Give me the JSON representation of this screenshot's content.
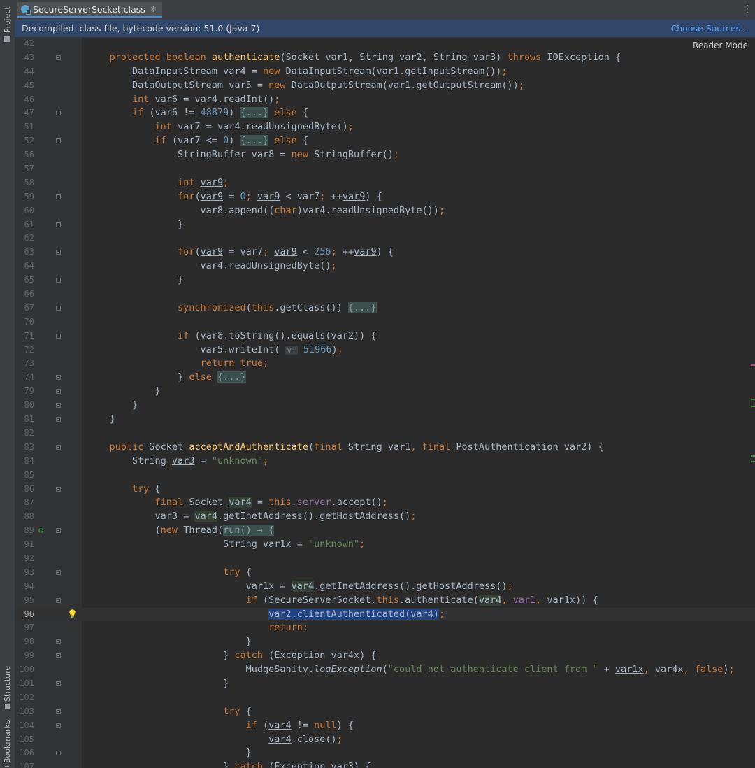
{
  "left_strip": {
    "tabs": [
      {
        "label": "Project"
      },
      {
        "label": "Structure"
      },
      {
        "label": "Bookmarks"
      }
    ]
  },
  "tab": {
    "title": "SecureServerSocket.class",
    "pin": "✻",
    "icon": "java-class-icon"
  },
  "banner": {
    "text": "Decompiled .class file, bytecode version: 51.0 (Java 7)",
    "link": "Choose Sources..."
  },
  "reader_mode": "Reader Mode",
  "editor": {
    "current_line": 96,
    "lines": [
      {
        "n": "42",
        "fold": "",
        "t": []
      },
      {
        "n": "43",
        "fold": "open",
        "t": [
          [
            "    "
          ],
          [
            "protected",
            "kw"
          ],
          [
            " "
          ],
          [
            "boolean",
            "kw"
          ],
          [
            " "
          ],
          [
            "authenticate",
            "fn"
          ],
          [
            "(Socket var1, String var2, String var3) "
          ],
          [
            "throws",
            "kw"
          ],
          [
            " IOException {"
          ]
        ]
      },
      {
        "n": "44",
        "fold": "",
        "t": [
          [
            "        DataInputStream var4 = "
          ],
          [
            "new",
            "kw"
          ],
          [
            " DataInputStream(var1.getInputStream())"
          ],
          [
            ";",
            "kw"
          ]
        ]
      },
      {
        "n": "45",
        "fold": "",
        "t": [
          [
            "        DataOutputStream var5 = "
          ],
          [
            "new",
            "kw"
          ],
          [
            " DataOutputStream(var1.getOutputStream())"
          ],
          [
            ";",
            "kw"
          ]
        ]
      },
      {
        "n": "46",
        "fold": "",
        "t": [
          [
            "        "
          ],
          [
            "int",
            "kw"
          ],
          [
            " var6 = var4.readInt()"
          ],
          [
            ";",
            "kw"
          ]
        ]
      },
      {
        "n": "47",
        "fold": "open",
        "t": [
          [
            "        "
          ],
          [
            "if",
            "kw"
          ],
          [
            " (var6 != "
          ],
          [
            "48879",
            "num"
          ],
          [
            ") "
          ],
          [
            "{...}",
            "fold"
          ],
          [
            " "
          ],
          [
            "else",
            "kw"
          ],
          [
            " {"
          ]
        ]
      },
      {
        "n": "51",
        "fold": "",
        "t": [
          [
            "            "
          ],
          [
            "int",
            "kw"
          ],
          [
            " var7 = var4.readUnsignedByte()"
          ],
          [
            ";",
            "kw"
          ]
        ]
      },
      {
        "n": "52",
        "fold": "open",
        "t": [
          [
            "            "
          ],
          [
            "if",
            "kw"
          ],
          [
            " (var7 <= "
          ],
          [
            "0",
            "num"
          ],
          [
            ") "
          ],
          [
            "{...}",
            "fold"
          ],
          [
            " "
          ],
          [
            "else",
            "kw"
          ],
          [
            " {"
          ]
        ]
      },
      {
        "n": "56",
        "fold": "",
        "t": [
          [
            "                StringBuffer var8 = "
          ],
          [
            "new",
            "kw"
          ],
          [
            " StringBuffer()"
          ],
          [
            ";",
            "kw"
          ]
        ]
      },
      {
        "n": "57",
        "fold": "",
        "t": []
      },
      {
        "n": "58",
        "fold": "",
        "t": [
          [
            "                "
          ],
          [
            "int",
            "kw"
          ],
          [
            " "
          ],
          [
            "var9",
            "ul"
          ],
          [
            ";",
            "kw"
          ]
        ]
      },
      {
        "n": "59",
        "fold": "open",
        "t": [
          [
            "                "
          ],
          [
            "for",
            "kw"
          ],
          [
            "("
          ],
          [
            "var9",
            "ul"
          ],
          [
            " = "
          ],
          [
            "0",
            "num"
          ],
          [
            "; ",
            "kw"
          ],
          [
            "var9",
            "ul"
          ],
          [
            " < var7"
          ],
          [
            "; ",
            "kw"
          ],
          [
            "++"
          ],
          [
            "var9",
            "ul"
          ],
          [
            ") {"
          ]
        ]
      },
      {
        "n": "60",
        "fold": "",
        "t": [
          [
            "                    var8.append(("
          ],
          [
            "char",
            "kw"
          ],
          [
            ")var4.readUnsignedByte())"
          ],
          [
            ";",
            "kw"
          ]
        ]
      },
      {
        "n": "61",
        "fold": "open",
        "t": [
          [
            "                }"
          ]
        ]
      },
      {
        "n": "62",
        "fold": "",
        "t": []
      },
      {
        "n": "63",
        "fold": "open",
        "t": [
          [
            "                "
          ],
          [
            "for",
            "kw"
          ],
          [
            "("
          ],
          [
            "var9",
            "ul"
          ],
          [
            " = var7"
          ],
          [
            "; ",
            "kw"
          ],
          [
            "var9",
            "ul"
          ],
          [
            " < "
          ],
          [
            "256",
            "num"
          ],
          [
            "; ",
            "kw"
          ],
          [
            "++"
          ],
          [
            "var9",
            "ul"
          ],
          [
            ") {"
          ]
        ]
      },
      {
        "n": "64",
        "fold": "",
        "t": [
          [
            "                    var4.readUnsignedByte()"
          ],
          [
            ";",
            "kw"
          ]
        ]
      },
      {
        "n": "65",
        "fold": "open",
        "t": [
          [
            "                }"
          ]
        ]
      },
      {
        "n": "66",
        "fold": "",
        "t": []
      },
      {
        "n": "67",
        "fold": "open",
        "t": [
          [
            "                "
          ],
          [
            "synchronized",
            "kw"
          ],
          [
            "("
          ],
          [
            "this",
            "kw"
          ],
          [
            ".getClass()) "
          ],
          [
            "{...}",
            "fold"
          ]
        ]
      },
      {
        "n": "70",
        "fold": "",
        "t": []
      },
      {
        "n": "71",
        "fold": "open",
        "t": [
          [
            "                "
          ],
          [
            "if",
            "kw"
          ],
          [
            " (var8.toString().equals(var2)) {"
          ]
        ]
      },
      {
        "n": "72",
        "fold": "",
        "t": [
          [
            "                    var5.writeInt( "
          ],
          [
            "v:",
            "hint"
          ],
          [
            " "
          ],
          [
            "51966",
            "num"
          ],
          [
            ")"
          ],
          [
            ";",
            "kw"
          ]
        ]
      },
      {
        "n": "73",
        "fold": "",
        "t": [
          [
            "                    "
          ],
          [
            "return true;",
            "kw"
          ]
        ]
      },
      {
        "n": "74",
        "fold": "open",
        "t": [
          [
            "                } "
          ],
          [
            "else",
            "kw"
          ],
          [
            " "
          ],
          [
            "{...}",
            "fold"
          ]
        ]
      },
      {
        "n": "79",
        "fold": "open",
        "t": [
          [
            "            }"
          ]
        ]
      },
      {
        "n": "80",
        "fold": "open",
        "t": [
          [
            "        }"
          ]
        ]
      },
      {
        "n": "81",
        "fold": "open",
        "t": [
          [
            "    }"
          ]
        ]
      },
      {
        "n": "82",
        "fold": "",
        "t": []
      },
      {
        "n": "83",
        "fold": "open",
        "t": [
          [
            "    "
          ],
          [
            "public",
            "kw"
          ],
          [
            " Socket "
          ],
          [
            "acceptAndAuthenticate",
            "fn"
          ],
          [
            "("
          ],
          [
            "final",
            "kw"
          ],
          [
            " String var1"
          ],
          [
            ", ",
            "kw"
          ],
          [
            "final",
            "kw"
          ],
          [
            " PostAuthentication var2) {"
          ]
        ]
      },
      {
        "n": "84",
        "fold": "",
        "t": [
          [
            "        String "
          ],
          [
            "var3",
            "ul"
          ],
          [
            " = "
          ],
          [
            "\"unknown\"",
            "str"
          ],
          [
            ";",
            "kw"
          ]
        ]
      },
      {
        "n": "85",
        "fold": "",
        "t": []
      },
      {
        "n": "86",
        "fold": "open",
        "t": [
          [
            "        "
          ],
          [
            "try",
            "kw"
          ],
          [
            " {"
          ]
        ]
      },
      {
        "n": "87",
        "fold": "",
        "t": [
          [
            "            "
          ],
          [
            "final",
            "kw"
          ],
          [
            " Socket "
          ],
          [
            "var4",
            "ulhl"
          ],
          [
            " = "
          ],
          [
            "this",
            "kw"
          ],
          [
            "."
          ],
          [
            "server",
            "fld"
          ],
          [
            ".accept()"
          ],
          [
            ";",
            "kw"
          ]
        ]
      },
      {
        "n": "88",
        "fold": "",
        "t": [
          [
            "            "
          ],
          [
            "var3",
            "ul"
          ],
          [
            " = "
          ],
          [
            "var4",
            "hl"
          ],
          [
            ".getInetAddress().getHostAddress()"
          ],
          [
            ";",
            "kw"
          ]
        ]
      },
      {
        "n": "89",
        "fold": "open",
        "run": true,
        "t": [
          [
            "            ("
          ],
          [
            "new",
            "kw"
          ],
          [
            " Thread("
          ],
          [
            "run() → {",
            "fold"
          ]
        ]
      },
      {
        "n": "91",
        "fold": "",
        "t": [
          [
            "                        String "
          ],
          [
            "var1x",
            "ul"
          ],
          [
            " = "
          ],
          [
            "\"unknown\"",
            "str"
          ],
          [
            ";",
            "kw"
          ]
        ]
      },
      {
        "n": "92",
        "fold": "",
        "t": []
      },
      {
        "n": "93",
        "fold": "open",
        "t": [
          [
            "                        "
          ],
          [
            "try",
            "kw"
          ],
          [
            " {"
          ]
        ]
      },
      {
        "n": "94",
        "fold": "",
        "t": [
          [
            "                            "
          ],
          [
            "var1x",
            "ul"
          ],
          [
            " = "
          ],
          [
            "var4",
            "ulhl"
          ],
          [
            ".getInetAddress().getHostAddress()"
          ],
          [
            ";",
            "kw"
          ]
        ]
      },
      {
        "n": "95",
        "fold": "open",
        "t": [
          [
            "                            "
          ],
          [
            "if",
            "kw"
          ],
          [
            " (SecureServerSocket."
          ],
          [
            "this",
            "kw"
          ],
          [
            ".authenticate("
          ],
          [
            "var4",
            "ulhl"
          ],
          [
            ", ",
            "kw"
          ],
          [
            "var1",
            "ulfld"
          ],
          [
            ", ",
            "kw"
          ],
          [
            "var1x",
            "ul"
          ],
          [
            ")) {"
          ]
        ]
      },
      {
        "n": "96",
        "fold": "",
        "bulb": true,
        "t": [
          [
            "                                "
          ],
          [
            "var2",
            "ulsel"
          ],
          [
            ".clientAuthenticated(",
            "sel"
          ],
          [
            "var4",
            "ulsel"
          ],
          [
            ")",
            "sel"
          ],
          [
            ";",
            "kw"
          ]
        ]
      },
      {
        "n": "97",
        "fold": "",
        "t": [
          [
            "                                "
          ],
          [
            "return;",
            "kw"
          ]
        ]
      },
      {
        "n": "98",
        "fold": "open",
        "t": [
          [
            "                            }"
          ]
        ]
      },
      {
        "n": "99",
        "fold": "open",
        "t": [
          [
            "                        } "
          ],
          [
            "catch",
            "kw"
          ],
          [
            " (Exception var4x) {"
          ]
        ]
      },
      {
        "n": "100",
        "fold": "",
        "t": [
          [
            "                            MudgeSanity."
          ],
          [
            "logException",
            "it"
          ],
          [
            "("
          ],
          [
            "\"could not authenticate client from \"",
            "str"
          ],
          [
            " + "
          ],
          [
            "var1x",
            "ul"
          ],
          [
            ", ",
            "kw"
          ],
          [
            "var4x"
          ],
          [
            ", ",
            "kw"
          ],
          [
            "false",
            "kw"
          ],
          [
            ")"
          ],
          [
            ";",
            "kw"
          ]
        ]
      },
      {
        "n": "101",
        "fold": "open",
        "t": [
          [
            "                        }"
          ]
        ]
      },
      {
        "n": "102",
        "fold": "",
        "t": []
      },
      {
        "n": "103",
        "fold": "open",
        "t": [
          [
            "                        "
          ],
          [
            "try",
            "kw"
          ],
          [
            " {"
          ]
        ]
      },
      {
        "n": "104",
        "fold": "open",
        "t": [
          [
            "                            "
          ],
          [
            "if",
            "kw"
          ],
          [
            " ("
          ],
          [
            "var4",
            "ul"
          ],
          [
            " != "
          ],
          [
            "null",
            "kw"
          ],
          [
            ") {"
          ]
        ]
      },
      {
        "n": "105",
        "fold": "",
        "t": [
          [
            "                                "
          ],
          [
            "var4",
            "ul"
          ],
          [
            ".close()"
          ],
          [
            ";",
            "kw"
          ]
        ]
      },
      {
        "n": "106",
        "fold": "open",
        "t": [
          [
            "                            }"
          ]
        ]
      },
      {
        "n": "107",
        "fold": "",
        "t": [
          [
            "                        } "
          ],
          [
            "catch",
            "kw"
          ],
          [
            " (Exception var3) {"
          ]
        ]
      }
    ]
  },
  "colors": {
    "background": "#2b2b2b",
    "keyword": "#cc7832",
    "string": "#6a8759",
    "number": "#6897bb",
    "method": "#ffc66d",
    "field": "#9876aa",
    "banner": "#30476a",
    "link": "#589df6"
  }
}
